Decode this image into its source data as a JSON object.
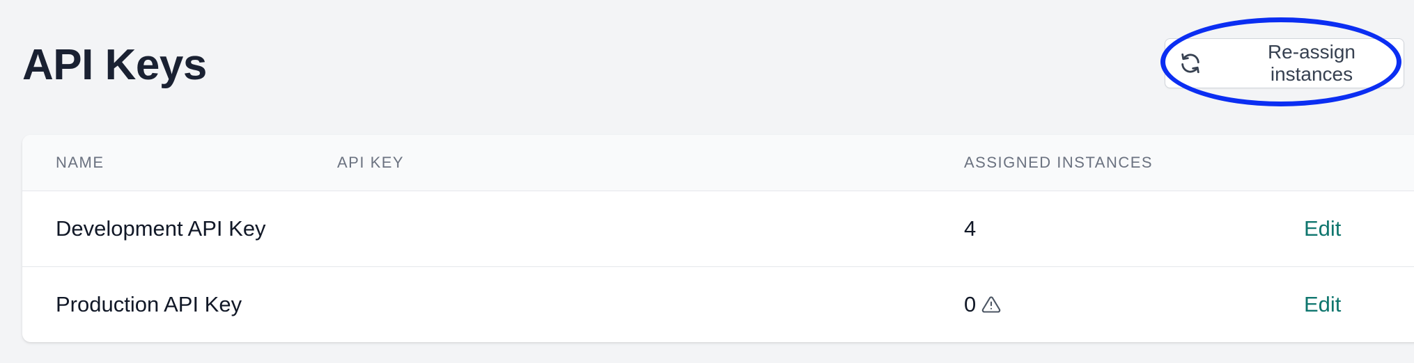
{
  "page": {
    "title": "API Keys"
  },
  "toolbar": {
    "reassign_label": "Re-assign instances",
    "reassign_icon": "refresh-icon"
  },
  "table": {
    "columns": [
      "Name",
      "API Key",
      "Assigned Instances"
    ],
    "rows": [
      {
        "name": "Development API Key",
        "api_key": "",
        "assigned_instances": "4",
        "warning": false,
        "action": "Edit"
      },
      {
        "name": "Production API Key",
        "api_key": "",
        "assigned_instances": "0",
        "warning": true,
        "warning_icon": "warning-triangle-icon",
        "action": "Edit"
      }
    ]
  },
  "colors": {
    "background": "#f3f4f6",
    "link": "#0f766e",
    "annotation": "#0b2ef2"
  }
}
